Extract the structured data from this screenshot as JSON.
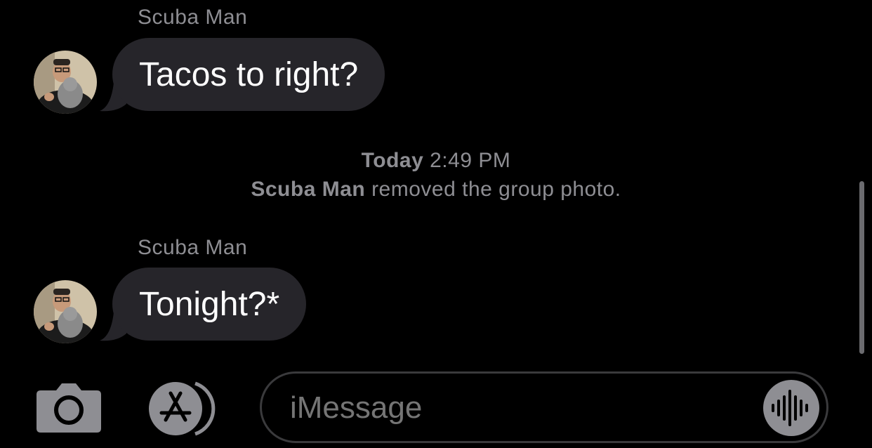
{
  "messages": [
    {
      "sender": "Scuba Man",
      "text": "Tacos to right?"
    },
    {
      "sender": "Scuba Man",
      "text": "Tonight?*"
    }
  ],
  "system_notice": {
    "day": "Today",
    "time": "2:49 PM",
    "actor": "Scuba Man",
    "action": "removed the group photo."
  },
  "composer": {
    "placeholder": "iMessage",
    "camera_icon": "camera-icon",
    "apps_icon": "app-store-icon",
    "audio_icon": "waveform-icon"
  },
  "colors": {
    "background": "#000000",
    "bubble": "#26252a",
    "secondary_text": "#8e8e93"
  }
}
